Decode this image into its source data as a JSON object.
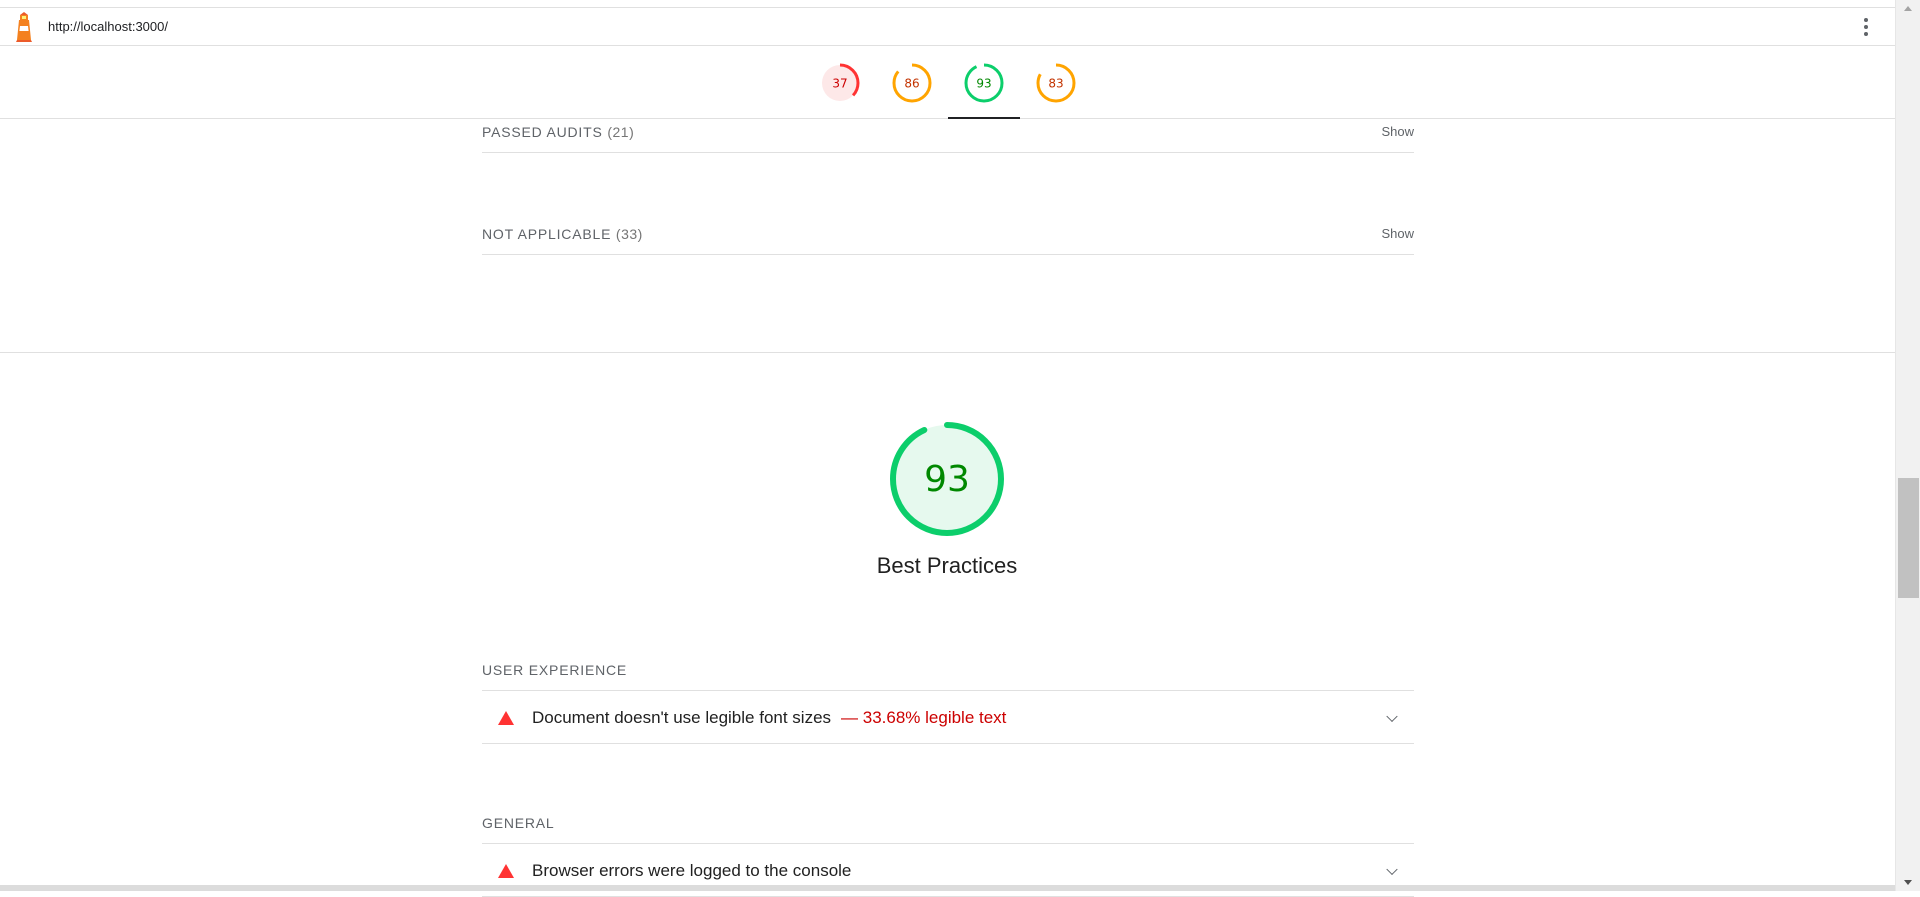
{
  "topbar": {
    "url": "http://localhost:3000/",
    "logo_icon": "lighthouse-icon",
    "menu_icon": "kebab-menu-icon"
  },
  "score_tabs": [
    {
      "score": "37",
      "level": "fail",
      "color": "#ff3333",
      "fraction": 0.37
    },
    {
      "score": "86",
      "level": "average",
      "color": "#ffa400",
      "fraction": 0.86
    },
    {
      "score": "93",
      "level": "pass",
      "color": "#0cce6b",
      "fraction": 0.93,
      "active": true
    },
    {
      "score": "83",
      "level": "average",
      "color": "#ffa400",
      "fraction": 0.83
    }
  ],
  "groups": {
    "passed": {
      "label": "PASSED AUDITS",
      "count": "(21)",
      "action": "Show"
    },
    "not_applicable": {
      "label": "NOT APPLICABLE",
      "count": "(33)",
      "action": "Show"
    }
  },
  "category": {
    "score": "93",
    "fraction": 0.93,
    "title": "Best Practices",
    "color": "#0cce6b"
  },
  "sections": {
    "user_experience": {
      "title": "USER EXPERIENCE",
      "audits": [
        {
          "title": "Document doesn't use legible font sizes",
          "display": "— 33.68% legible text",
          "status": "fail"
        }
      ]
    },
    "general": {
      "title": "GENERAL",
      "audits": [
        {
          "title": "Browser errors were logged to the console",
          "display": "",
          "status": "fail"
        }
      ]
    }
  },
  "colors": {
    "fail": "#ff3333",
    "average": "#ffa400",
    "pass": "#0cce6b",
    "fail_text": "#cc0000",
    "pass_text": "#008800",
    "average_text": "#c33300"
  }
}
